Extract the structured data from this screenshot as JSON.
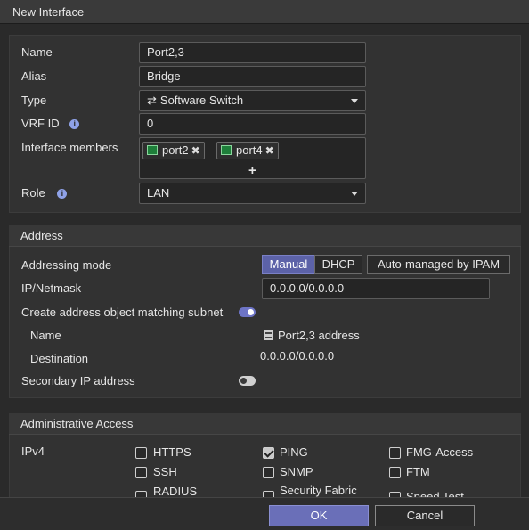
{
  "dialog": {
    "title": "New Interface"
  },
  "form": {
    "name_label": "Name",
    "name_value": "Port2,3",
    "alias_label": "Alias",
    "alias_value": "Bridge",
    "type_label": "Type",
    "type_value": "Software Switch",
    "type_icon": "switch-arrows-icon",
    "vrf_label": "VRF ID",
    "vrf_value": "0",
    "members_label": "Interface members",
    "members": [
      {
        "name": "port2",
        "icon": "port-icon"
      },
      {
        "name": "port4",
        "icon": "port-icon"
      }
    ],
    "add_member_label": "+",
    "role_label": "Role",
    "role_value": "LAN"
  },
  "address": {
    "heading": "Address",
    "addressing_mode_label": "Addressing mode",
    "modes": [
      "Manual",
      "DHCP",
      "Auto-managed by IPAM"
    ],
    "selected_mode": "Manual",
    "ipmask_label": "IP/Netmask",
    "ipmask_value": "0.0.0.0/0.0.0.0",
    "create_object_label": "Create address object matching subnet",
    "create_object_enabled": true,
    "object_name_label": "Name",
    "object_name_value": "Port2,3 address",
    "destination_label": "Destination",
    "destination_value": "0.0.0.0/0.0.0.0",
    "secondary_ip_label": "Secondary IP address",
    "secondary_ip_enabled": false
  },
  "admin_access": {
    "heading": "Administrative Access",
    "ipv4_label": "IPv4",
    "options": [
      {
        "label": "HTTPS",
        "checked": false
      },
      {
        "label": "PING",
        "checked": true
      },
      {
        "label": "FMG-Access",
        "checked": false
      },
      {
        "label": "SSH",
        "checked": false
      },
      {
        "label": "SNMP",
        "checked": false
      },
      {
        "label": "FTM",
        "checked": false
      },
      {
        "label": "RADIUS",
        "checked": false
      },
      {
        "label": "Security Fabric",
        "checked": false
      },
      {
        "label": "Speed Test",
        "checked": false
      }
    ]
  },
  "footer": {
    "ok_label": "OK",
    "cancel_label": "Cancel"
  },
  "colors": {
    "accent": "#6a6fb8",
    "background": "#2a2a2a",
    "toggle_on": "#6d74c6"
  }
}
